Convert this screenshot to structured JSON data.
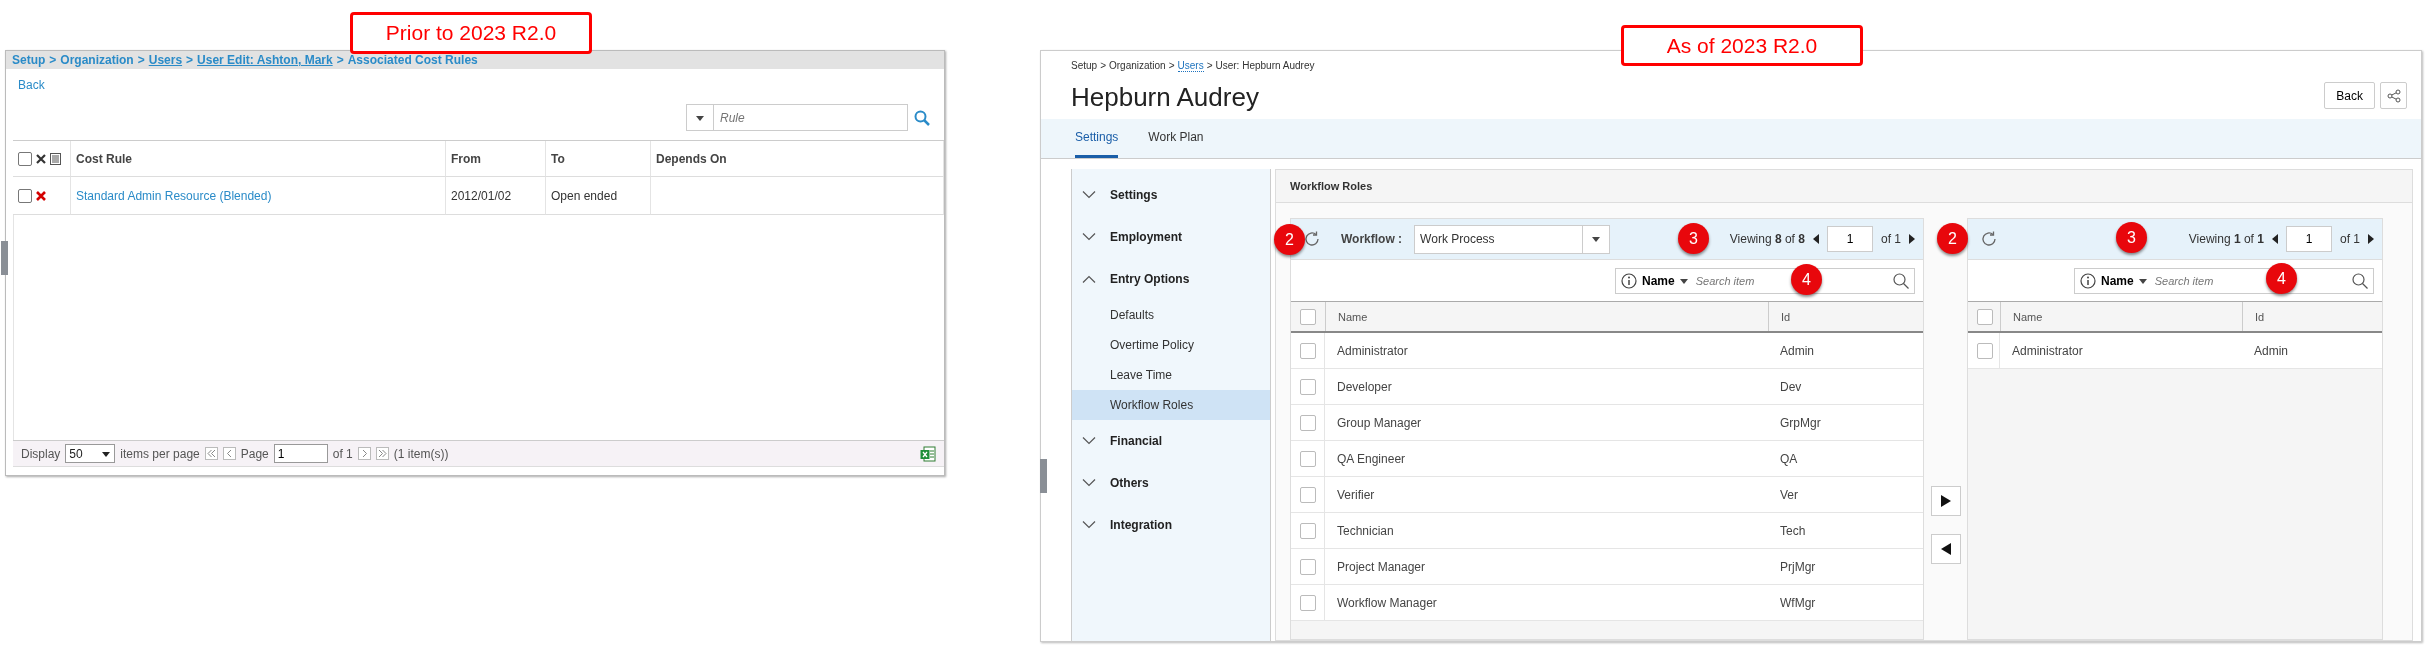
{
  "before": {
    "callout": "Prior to 2023 R2.0",
    "breadcrumb": [
      {
        "label": "Setup",
        "underlined": false,
        "separator": ">"
      },
      {
        "label": "Organization",
        "underlined": false,
        "separator": ">"
      },
      {
        "label": "Users",
        "underlined": true,
        "separator": ">"
      },
      {
        "label": "User Edit: Ashton, Mark",
        "underlined": true,
        "separator": ">"
      },
      {
        "label": "Associated Cost Rules",
        "underlined": false
      }
    ],
    "back": "Back",
    "filter": {
      "placeholder": "Rule"
    },
    "table": {
      "columns": [
        "Cost Rule",
        "From",
        "To",
        "Depends On"
      ],
      "all_checked": false,
      "rows": [
        {
          "checked": false,
          "cost_rule": "Standard Admin Resource (Blended)",
          "from": "2012/01/02",
          "to": "Open ended"
        }
      ]
    },
    "footer": {
      "display": "Display",
      "per_page": "50",
      "items_per_page": "items per page",
      "page_label": "Page",
      "page": "1",
      "page_count": "of 1",
      "total": "(1 item(s))"
    }
  },
  "after": {
    "callout": "As of 2023 R2.0",
    "breadcrumb": [
      {
        "label": "Setup",
        "link": false,
        "separator": ">"
      },
      {
        "label": "Organization",
        "link": false,
        "separator": ">"
      },
      {
        "label": "Users",
        "link": true,
        "separator": ">"
      },
      {
        "label": "User: Hepburn Audrey",
        "link": false
      }
    ],
    "title": "Hepburn Audrey",
    "back_button": "Back",
    "tabs": [
      {
        "label": "Settings",
        "selected": true
      },
      {
        "label": "Work Plan",
        "selected": false
      }
    ],
    "sidebar": {
      "items": [
        {
          "label": "Settings",
          "expanded": false
        },
        {
          "label": "Employment",
          "expanded": false
        },
        {
          "label": "Entry Options",
          "expanded": true,
          "children": [
            {
              "label": "Defaults",
              "selected": false
            },
            {
              "label": "Overtime Policy",
              "selected": false
            },
            {
              "label": "Leave Time",
              "selected": false
            },
            {
              "label": "Workflow Roles",
              "selected": true
            }
          ]
        },
        {
          "label": "Financial",
          "expanded": false
        },
        {
          "label": "Others",
          "expanded": false
        },
        {
          "label": "Integration",
          "expanded": false
        }
      ]
    },
    "panel_title": "Workflow Roles",
    "available": {
      "workflow_label": "Workflow :",
      "workflow": "Work Process",
      "viewing": "Viewing **8** of **8**",
      "page": "1",
      "page_count": "of 1",
      "search_field": "Name",
      "search_placeholder": "Search item",
      "columns": [
        "Name",
        "Id"
      ],
      "all_checked": false,
      "badges": [
        "2",
        "3",
        "4"
      ],
      "rows": [
        {
          "name": "Administrator",
          "id": "Admin",
          "checked": false
        },
        {
          "name": "Developer",
          "id": "Dev",
          "checked": false
        },
        {
          "name": "Group Manager",
          "id": "GrpMgr",
          "checked": false
        },
        {
          "name": "QA Engineer",
          "id": "QA",
          "checked": false
        },
        {
          "name": "Verifier",
          "id": "Ver",
          "checked": false
        },
        {
          "name": "Technician",
          "id": "Tech",
          "checked": false
        },
        {
          "name": "Project Manager",
          "id": "PrjMgr",
          "checked": false
        },
        {
          "name": "Workflow Manager",
          "id": "WfMgr",
          "checked": false
        }
      ]
    },
    "assigned": {
      "viewing": "Viewing **1** of **1**",
      "page": "1",
      "page_count": "of 1",
      "search_field": "Name",
      "search_placeholder": "Search item",
      "columns": [
        "Name",
        "Id"
      ],
      "all_checked": false,
      "badges": [
        "2",
        "3",
        "4"
      ],
      "rows": [
        {
          "name": "Administrator",
          "id": "Admin",
          "checked": false
        }
      ]
    }
  }
}
